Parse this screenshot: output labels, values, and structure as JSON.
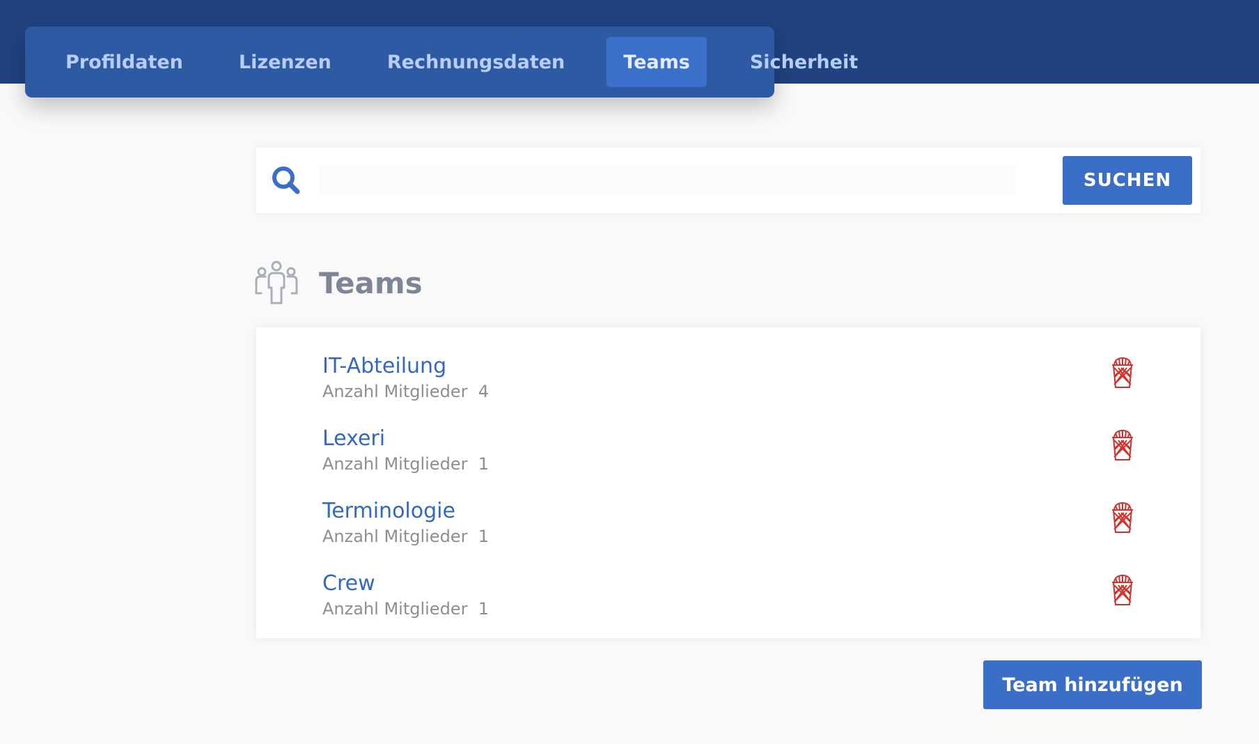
{
  "nav": {
    "tabs": [
      {
        "label": "Profildaten"
      },
      {
        "label": "Lizenzen"
      },
      {
        "label": "Rechnungsdaten"
      },
      {
        "label": "Teams",
        "active": true
      },
      {
        "label": "Sicherheit"
      }
    ]
  },
  "search": {
    "value": "",
    "placeholder": "",
    "button_label": "SUCHEN",
    "icon": "search-icon"
  },
  "teams": {
    "title": "Teams",
    "icon": "people-group-icon",
    "member_label": "Anzahl Mitglieder",
    "items": [
      {
        "name": "IT-Abteilung",
        "members": "4"
      },
      {
        "name": "Lexeri",
        "members": "1"
      },
      {
        "name": "Terminologie",
        "members": "1"
      },
      {
        "name": "Crew",
        "members": "1"
      }
    ],
    "delete_icon": "trash-icon",
    "add_button_label": "Team hinzufügen"
  },
  "colors": {
    "header_bg": "#204280",
    "nav_bg": "#2d5aa3",
    "active_tab": "#3a70c9",
    "accent": "#3b6fc7",
    "link": "#3268bf",
    "delete": "#d1322c"
  }
}
